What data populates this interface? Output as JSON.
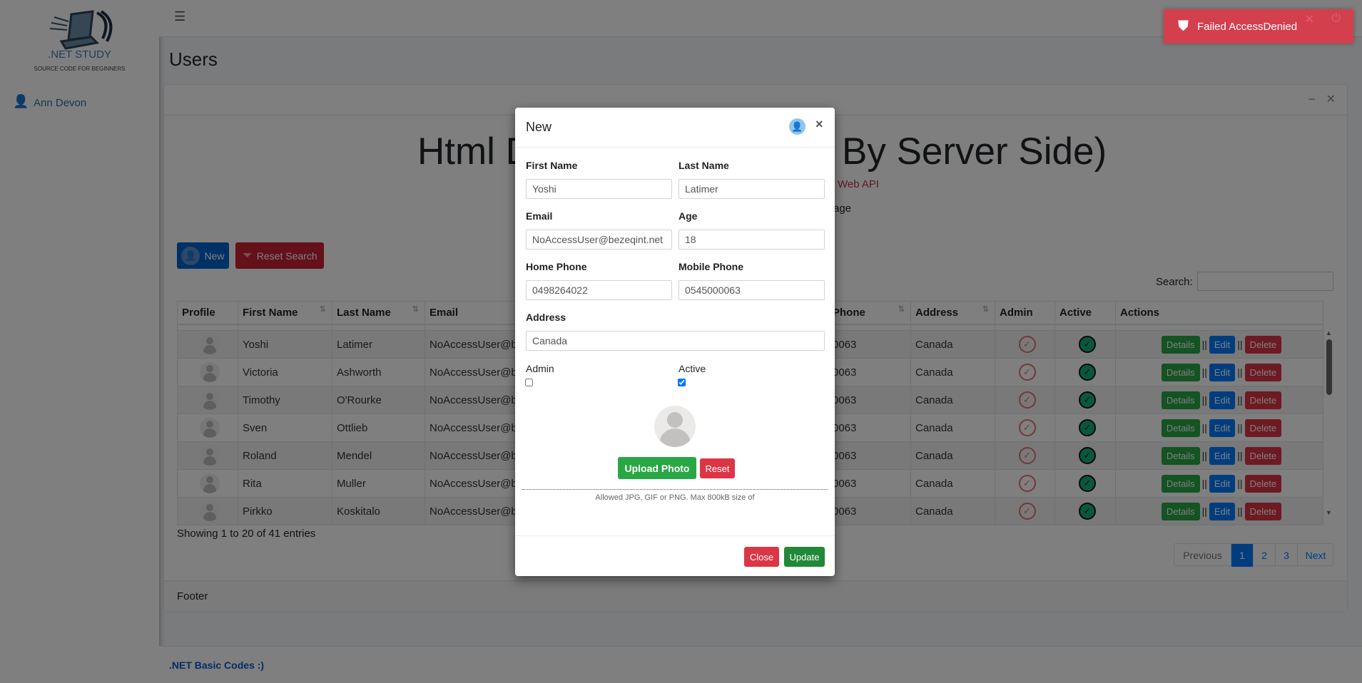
{
  "sidebar": {
    "logo_title": ".NET STUDY",
    "logo_subtitle": "SOURCE CODE FOR BEGINNERS",
    "user_name": "Ann Devon"
  },
  "topbar": {
    "menu_icon": "hamburger-icon"
  },
  "page": {
    "title": "Users"
  },
  "card": {
    "heading_left": "Html D",
    "heading_right": "By Server Side)",
    "subtitle_fragment": "Web API",
    "text_fragment": "age",
    "new_label": "New",
    "reset_search_label": "Reset Search",
    "search_label": "Search:",
    "search_value": "",
    "columns": [
      "Profile",
      "First Name",
      "Last Name",
      "Email",
      "Phone",
      "Address",
      "Admin",
      "Active",
      "Actions"
    ],
    "rows": [
      {
        "first": "Yoshi",
        "last": "Latimer",
        "email": "NoAccessUser@be",
        "phone": "0063",
        "address": "Canada"
      },
      {
        "first": "Victoria",
        "last": "Ashworth",
        "email": "NoAccessUser@be",
        "phone": "0063",
        "address": "Canada"
      },
      {
        "first": "Timothy",
        "last": "O'Rourke",
        "email": "NoAccessUser@be",
        "phone": "0063",
        "address": "Canada"
      },
      {
        "first": "Sven",
        "last": "Ottlieb",
        "email": "NoAccessUser@be",
        "phone": "0063",
        "address": "Canada"
      },
      {
        "first": "Roland",
        "last": "Mendel",
        "email": "NoAccessUser@be",
        "phone": "0063",
        "address": "Canada"
      },
      {
        "first": "Rita",
        "last": "Muller",
        "email": "NoAccessUser@be",
        "phone": "0063",
        "address": "Canada"
      },
      {
        "first": "Pirkko",
        "last": "Koskitalo",
        "email": "NoAccessUser@be",
        "phone": "0063",
        "address": "Canada"
      }
    ],
    "action_labels": {
      "details": "Details",
      "edit": "Edit",
      "delete": "Delete",
      "sep": "||"
    },
    "info": "Showing 1 to 20 of 41 entries",
    "pagination": {
      "previous": "Previous",
      "pages": [
        "1",
        "2",
        "3"
      ],
      "next": "Next",
      "current": "1"
    },
    "footer": "Footer"
  },
  "footer": {
    "text": ".NET Basic Codes :)"
  },
  "toast": {
    "message": "Failed AccessDenied",
    "color": "#d43f4e"
  },
  "modal": {
    "title": "New",
    "fields": {
      "first_name": {
        "label": "First Name",
        "value": "Yoshi"
      },
      "last_name": {
        "label": "Last Name",
        "value": "Latimer"
      },
      "email": {
        "label": "Email",
        "value": "NoAccessUser@bezeqint.net"
      },
      "age": {
        "label": "Age",
        "value": "18"
      },
      "home_phone": {
        "label": "Home Phone",
        "value": "0498264022"
      },
      "mobile_phone": {
        "label": "Mobile Phone",
        "value": "0545000063"
      },
      "address": {
        "label": "Address",
        "value": "Canada"
      },
      "admin": {
        "label": "Admin",
        "checked": false
      },
      "active": {
        "label": "Active",
        "checked": true
      }
    },
    "upload_label": "Upload Photo",
    "reset_label": "Reset",
    "hint": "Allowed JPG, GIF or PNG. Max 800kB size of",
    "close_label": "Close",
    "update_label": "Update"
  }
}
